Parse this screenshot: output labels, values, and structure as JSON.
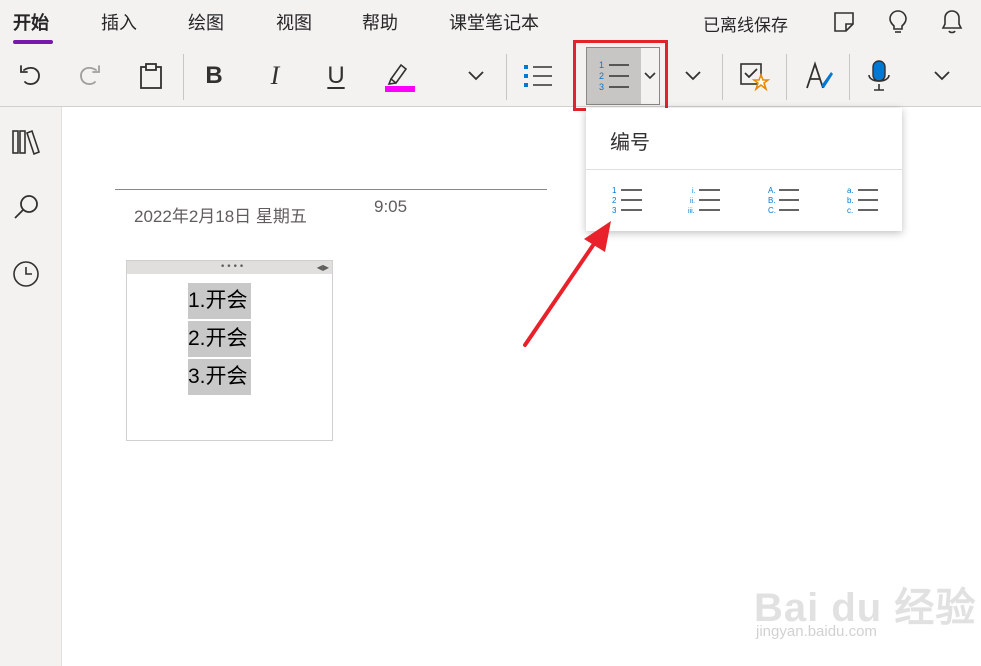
{
  "tabs": [
    {
      "label": "开始",
      "active": true
    },
    {
      "label": "插入"
    },
    {
      "label": "绘图"
    },
    {
      "label": "视图"
    },
    {
      "label": "帮助"
    },
    {
      "label": "课堂笔记本"
    }
  ],
  "status": {
    "sync_text": "已离线保存"
  },
  "ribbon": {
    "bold_label": "B",
    "italic_label": "I",
    "underline_label": "U",
    "highlight_color": "#ff00ff",
    "accent_blue": "#0078d4"
  },
  "numbering_menu": {
    "title": "编号",
    "options": [
      "1-2-3",
      "i-ii-iii",
      "A-B-C",
      "a-b-c"
    ]
  },
  "page": {
    "date": "2022年2月18日 星期五",
    "time": "9:05",
    "list_items": [
      "1.开会",
      "2.开会",
      "3.开会"
    ]
  },
  "watermark": {
    "logo": "Bai du 经验",
    "url": "jingyan.baidu.com"
  }
}
